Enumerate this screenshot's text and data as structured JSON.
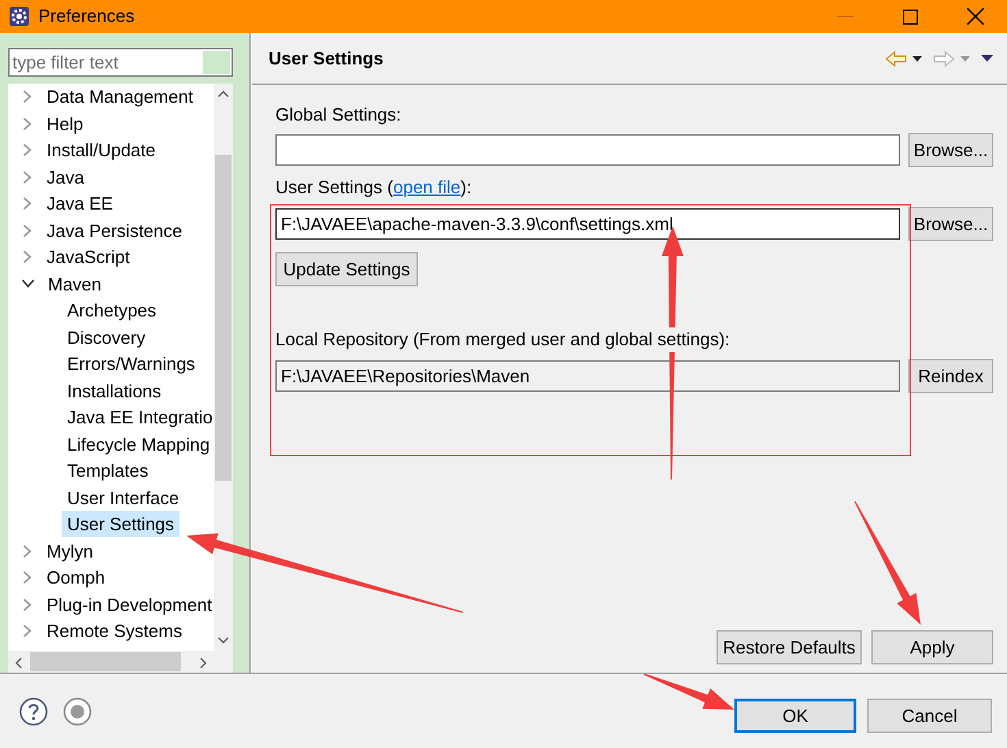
{
  "window": {
    "title": "Preferences"
  },
  "filter": {
    "placeholder": "type filter text"
  },
  "tree": [
    {
      "label": "Data Management",
      "expanded": false,
      "selected": false
    },
    {
      "label": "Help",
      "expanded": false,
      "selected": false
    },
    {
      "label": "Install/Update",
      "expanded": false,
      "selected": false
    },
    {
      "label": "Java",
      "expanded": false,
      "selected": false
    },
    {
      "label": "Java EE",
      "expanded": false,
      "selected": false
    },
    {
      "label": "Java Persistence",
      "expanded": false,
      "selected": false
    },
    {
      "label": "JavaScript",
      "expanded": false,
      "selected": false
    },
    {
      "label": "Maven",
      "expanded": true,
      "selected": false,
      "children": [
        {
          "label": "Archetypes",
          "selected": false
        },
        {
          "label": "Discovery",
          "selected": false
        },
        {
          "label": "Errors/Warnings",
          "selected": false
        },
        {
          "label": "Installations",
          "selected": false
        },
        {
          "label": "Java EE Integratio",
          "selected": false
        },
        {
          "label": "Lifecycle Mapping",
          "selected": false
        },
        {
          "label": "Templates",
          "selected": false
        },
        {
          "label": "User Interface",
          "selected": false
        },
        {
          "label": "User Settings",
          "selected": true
        }
      ]
    },
    {
      "label": "Mylyn",
      "expanded": false,
      "selected": false
    },
    {
      "label": "Oomph",
      "expanded": false,
      "selected": false
    },
    {
      "label": "Plug-in Development",
      "expanded": false,
      "selected": false
    },
    {
      "label": "Remote Systems",
      "expanded": false,
      "selected": false
    }
  ],
  "page": {
    "title": "User Settings"
  },
  "global_settings": {
    "label": "Global Settings:",
    "button": "Browse..."
  },
  "user_settings": {
    "label_prefix": "User Settings (",
    "link": "open file",
    "label_suffix": "):",
    "value": "F:\\JAVAEE\\apache-maven-3.3.9\\conf\\settings.xml",
    "button": "Browse..."
  },
  "update_button": "Update Settings",
  "local_repository": {
    "label": "Local Repository (From merged user and global settings):",
    "value": "F:\\JAVAEE\\Repositories\\Maven",
    "button": "Reindex"
  },
  "page_buttons": [
    "Restore Defaults",
    "Apply"
  ],
  "dialog_buttons": [
    {
      "label": "OK",
      "default": true
    },
    {
      "label": "Cancel",
      "default": false
    }
  ]
}
